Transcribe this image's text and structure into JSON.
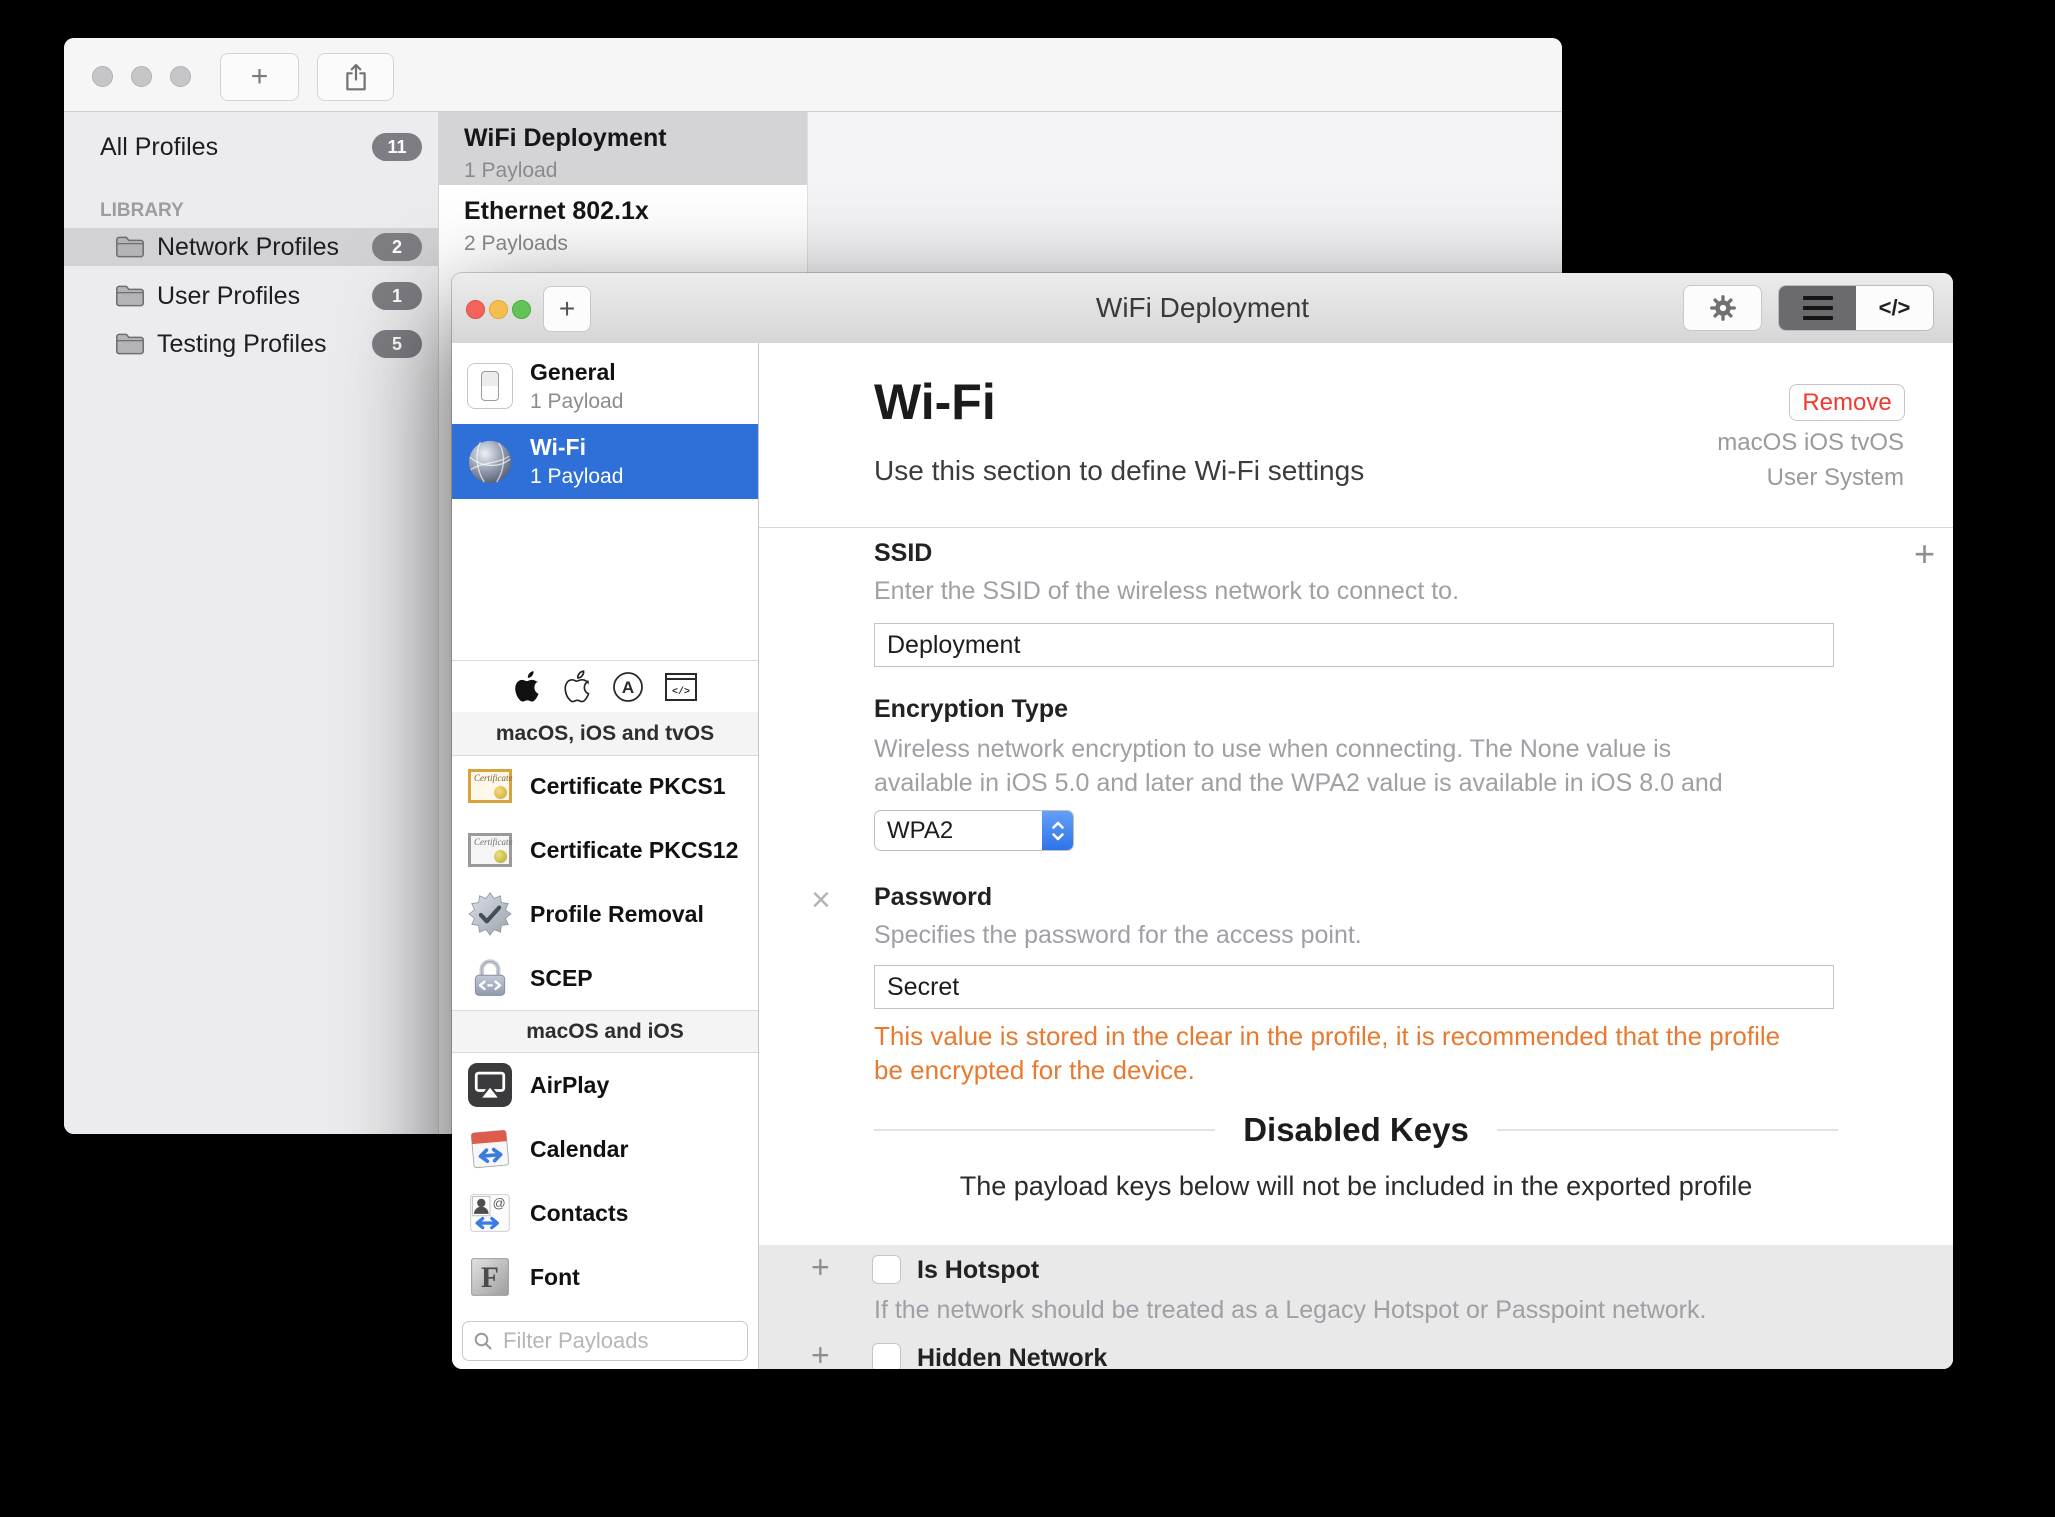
{
  "colors": {
    "selection_blue": "#2e6fd8",
    "warning_orange": "#e87a2f",
    "remove_red": "#ef3a30",
    "badge_gray": "#7d7d83"
  },
  "profiles_window": {
    "sidebar": {
      "all_profiles_label": "All Profiles",
      "all_profiles_count": "11",
      "library_header": "LIBRARY",
      "folders": [
        {
          "label": "Network Profiles",
          "count": "2"
        },
        {
          "label": "User Profiles",
          "count": "1"
        },
        {
          "label": "Testing Profiles",
          "count": "5"
        }
      ]
    },
    "profile_list": [
      {
        "title": "WiFi Deployment",
        "subtitle": "1 Payload"
      },
      {
        "title": "Ethernet 802.1x",
        "subtitle": "2 Payloads"
      }
    ]
  },
  "editor_window": {
    "title": "WiFi Deployment",
    "toolbar": {
      "code_view_label": "</>"
    },
    "sidebar": {
      "payloads": [
        {
          "label": "General",
          "subtitle": "1 Payload"
        },
        {
          "label": "Wi-Fi",
          "subtitle": "1 Payload"
        }
      ],
      "sections": [
        {
          "header": "macOS, iOS and tvOS",
          "items": [
            "Certificate PKCS1",
            "Certificate PKCS12",
            "Profile Removal",
            "SCEP"
          ]
        },
        {
          "header": "macOS and iOS",
          "items": [
            "AirPlay",
            "Calendar",
            "Contacts",
            "Font"
          ]
        }
      ],
      "filter_placeholder": "Filter Payloads"
    },
    "content": {
      "heading": "Wi-Fi",
      "subheading": "Use this section to define Wi-Fi settings",
      "remove_button": "Remove",
      "platforms": "macOS iOS tvOS",
      "scope": "User System",
      "ssid": {
        "label": "SSID",
        "description": "Enter the SSID of the wireless network to connect to.",
        "value": "Deployment"
      },
      "encryption": {
        "label": "Encryption Type",
        "description_line1": "Wireless network encryption to use when connecting. The None value is",
        "description_line2": "available in iOS 5.0 and later and the WPA2 value is available in iOS 8.0 and",
        "value": "WPA2"
      },
      "password": {
        "label": "Password",
        "description": "Specifies the password for the access point.",
        "value": "Secret",
        "warning_line1": "This value is stored in the clear in the profile, it is recommended that the profile",
        "warning_line2": "be encrypted for the device."
      },
      "disabled_keys": {
        "title": "Disabled Keys",
        "description": "The payload keys below will not be included in the exported profile",
        "items": [
          {
            "label": "Is Hotspot",
            "description": "If the network should be treated as a Legacy Hotspot or Passpoint network."
          },
          {
            "label": "Hidden Network"
          }
        ]
      }
    }
  }
}
